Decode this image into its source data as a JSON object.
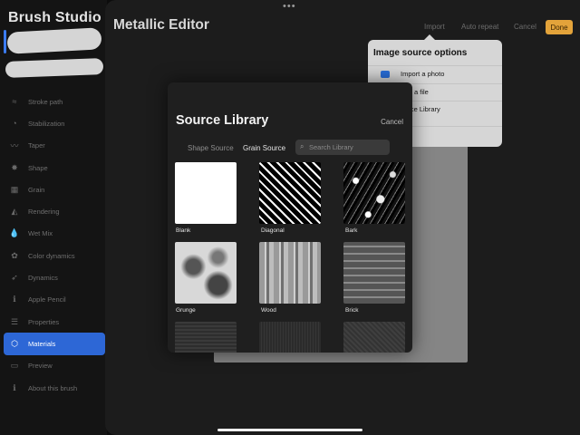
{
  "sidebar": {
    "app_title": "Brush Studio",
    "items": [
      {
        "label": "Stroke path",
        "icon": "stroke-path-icon",
        "glyph": "≈"
      },
      {
        "label": "Stabilization",
        "icon": "stabilization-icon",
        "glyph": "◔"
      },
      {
        "label": "Taper",
        "icon": "taper-icon",
        "glyph": "〰"
      },
      {
        "label": "Shape",
        "icon": "shape-icon",
        "glyph": "✸"
      },
      {
        "label": "Grain",
        "icon": "grain-icon",
        "glyph": "▦"
      },
      {
        "label": "Rendering",
        "icon": "rendering-icon",
        "glyph": "◭"
      },
      {
        "label": "Wet Mix",
        "icon": "wet-mix-icon",
        "glyph": "💧"
      },
      {
        "label": "Color dynamics",
        "icon": "color-dynamics-icon",
        "glyph": "✿"
      },
      {
        "label": "Dynamics",
        "icon": "dynamics-icon",
        "glyph": "➶"
      },
      {
        "label": "Apple Pencil",
        "icon": "apple-pencil-icon",
        "glyph": "ℹ"
      },
      {
        "label": "Properties",
        "icon": "properties-icon",
        "glyph": "☰"
      },
      {
        "label": "Materials",
        "icon": "materials-icon",
        "glyph": "⬡"
      },
      {
        "label": "Preview",
        "icon": "preview-icon",
        "glyph": "▭"
      },
      {
        "label": "About this brush",
        "icon": "about-icon",
        "glyph": "ℹ"
      }
    ],
    "active_index": 11
  },
  "editor": {
    "title": "Metallic Editor",
    "import_label": "Import",
    "auto_repeat_label": "Auto repeat",
    "cancel_label": "Cancel",
    "done_label": "Done",
    "more_glyph": "•••"
  },
  "popover": {
    "title": "Image source options",
    "items": [
      "Import a photo",
      "port a file",
      "ource Library",
      "te"
    ]
  },
  "library": {
    "title": "Source Library",
    "cancel_label": "Cancel",
    "tab_shape": "Shape Source",
    "tab_grain": "Grain Source",
    "search_placeholder": "Search Library",
    "search_glyph": "⌕",
    "textures": [
      {
        "label": "Blank"
      },
      {
        "label": "Diagonal"
      },
      {
        "label": "Bark"
      },
      {
        "label": "Grunge"
      },
      {
        "label": "Wood"
      },
      {
        "label": "Brick"
      },
      {
        "label": ""
      },
      {
        "label": ""
      },
      {
        "label": ""
      }
    ]
  },
  "colors": {
    "accent": "#2d67d6",
    "done_button": "#e3a33a"
  }
}
